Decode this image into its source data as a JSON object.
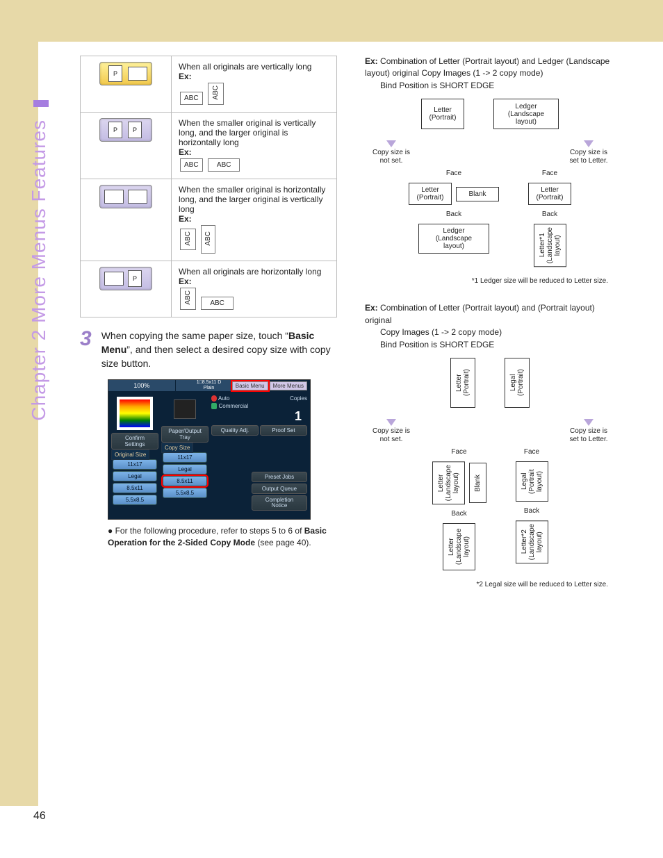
{
  "page_number": "46",
  "chapter_title": "Chapter 2    More Menus Features",
  "table": {
    "rows": [
      {
        "desc": "When all originals are vertically long",
        "ex_label": "Ex:",
        "cellA": "ABC",
        "cellA_vert": false,
        "cellB": "ABC",
        "cellB_vert": true,
        "selected": true,
        "iconA": "port",
        "iconB": "land"
      },
      {
        "desc": "When the smaller original is vertically long, and the larger original is horizontally long",
        "ex_label": "Ex:",
        "cellA": "ABC",
        "cellA_vert": false,
        "cellB": "ABC",
        "cellB_vert": false,
        "selected": false,
        "iconA": "port",
        "iconB": "port"
      },
      {
        "desc": "When the smaller original is horizontally long, and the larger original is vertically long",
        "ex_label": "Ex:",
        "cellA": "ABC",
        "cellA_vert": true,
        "cellB": "ABC",
        "cellB_vert": true,
        "selected": false,
        "iconA": "land",
        "iconB": "land"
      },
      {
        "desc": "When all originals are horizontally long",
        "ex_label": "Ex:",
        "cellA": "ABC",
        "cellA_vert": true,
        "cellB": "ABC",
        "cellB_vert": false,
        "selected": false,
        "iconA": "land",
        "iconB": "port"
      }
    ],
    "p_glyph": "P"
  },
  "step": {
    "num": "3",
    "text_a": "When copying the same paper size, touch “",
    "bold": "Basic Menu",
    "text_b": "”, and then select a desired copy size with copy size button."
  },
  "screen": {
    "top_left": "100%",
    "top_mid": "1□8.5x11 D\nPlain",
    "tab1": "Basic Menu",
    "tab2": "More Menus",
    "auto": "Auto",
    "commercial": "Commercial",
    "copies_lbl": "Copies",
    "copies_val": "1",
    "confirm": "Confirm Settings",
    "paper_tray": "Paper/Output Tray",
    "quality": "Quality Adj.",
    "proof": "Proof Set",
    "orig_size_hdr": "Original Size",
    "copy_size_hdr": "Copy Size",
    "sizes": [
      "11x17",
      "Legal",
      "8.5x11",
      "5.5x8.5"
    ],
    "sel_size": "8.5x11",
    "preset": "Preset Jobs",
    "output": "Output Queue",
    "completion": "Completion\nNotice"
  },
  "bullet_text_a": "For the following procedure, refer to steps 5 to 6 of ",
  "bullet_bold": "Basic Operation for the 2-Sided Copy Mode",
  "bullet_text_b": " (see page 40).",
  "ex1": {
    "label": "Ex:",
    "line1": "Combination of Letter (Portrait layout) and Ledger (Landscape layout) original Copy Images (1 -> 2 copy mode)",
    "line2": "Bind Position is SHORT EDGE",
    "boxA": "Letter\n(Portrait)",
    "boxB": "Ledger\n(Landscape\nlayout)",
    "cs_not": "Copy size is not set.",
    "cs_set": "Copy size is set to Letter.",
    "face": "Face",
    "back": "Back",
    "blank": "Blank",
    "letter_p": "Letter\n(Portrait)",
    "ledger_l": "Ledger\n(Landscape\nlayout)",
    "letter1_l": "Letter*1\n(Landscape\nlayout)",
    "foot": "*1  Ledger size will be reduced to Letter size."
  },
  "ex2": {
    "label": "Ex:",
    "line1": "Combination of Letter (Portrait layout) and (Portrait layout) original",
    "line2": "Copy Images (1 -> 2 copy mode)",
    "line3": "Bind Position is SHORT EDGE",
    "boxA": "Letter\n(Portrait)",
    "boxB": "Legal\n(Portrait)",
    "cs_not": "Copy size is not set.",
    "cs_set": "Copy size is set to Letter.",
    "face": "Face",
    "back": "Back",
    "blank": "Blank",
    "letter_ll": "Letter\n(Landscape\nlayout)",
    "legal_pl": "Legal\n(Portrait\nlayout)",
    "letter2_l": "Letter*2\n(Landscape\nlayout)",
    "foot": "*2  Legal size will be reduced to Letter size."
  }
}
